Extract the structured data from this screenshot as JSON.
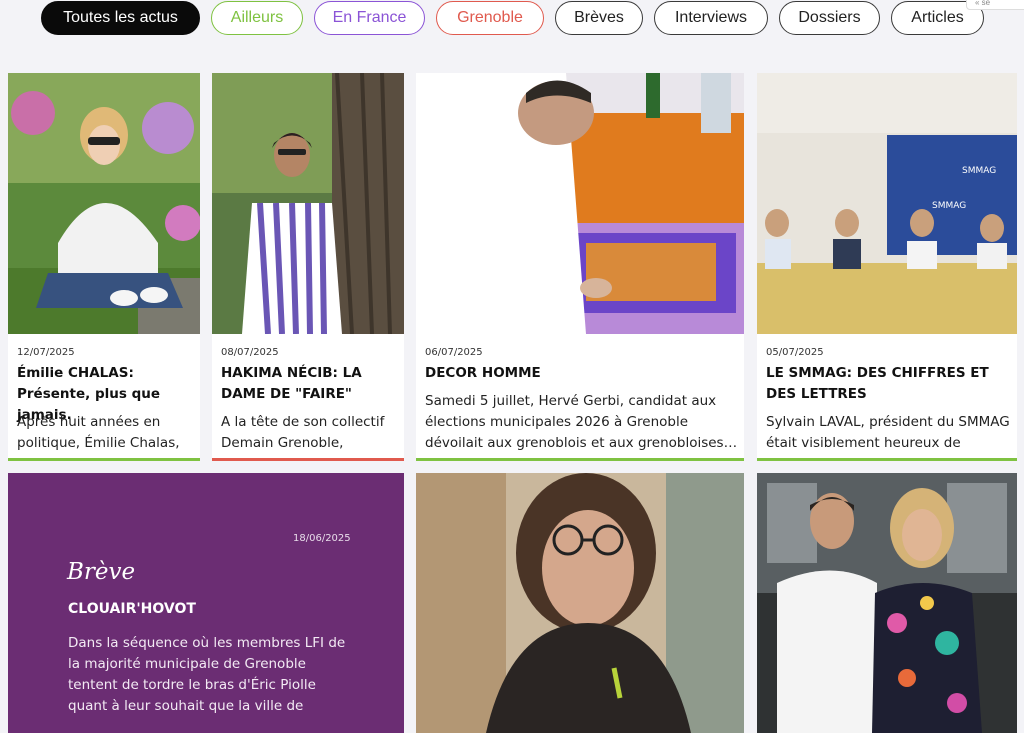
{
  "filters": [
    {
      "label": "Toutes les actus",
      "active": true,
      "color": "#0a0a0a"
    },
    {
      "label": "Ailleurs",
      "active": false,
      "color": "#7fc241"
    },
    {
      "label": "En France",
      "active": false,
      "color": "#8b54d6"
    },
    {
      "label": "Grenoble",
      "active": false,
      "color": "#e05a4e"
    },
    {
      "label": "Brèves",
      "active": false,
      "color": "#3a3a3a"
    },
    {
      "label": "Interviews",
      "active": false,
      "color": "#3a3a3a"
    },
    {
      "label": "Dossiers",
      "active": false,
      "color": "#3a3a3a"
    },
    {
      "label": "Articles",
      "active": false,
      "color": "#3a3a3a"
    }
  ],
  "corner_tab": "« se",
  "articles": [
    {
      "date": "12/07/2025",
      "title": "Émilie CHALAS: Présente, plus que jamais.",
      "excerpt": "Après huit années en politique, Émilie Chalas,",
      "accent": "#7fc241"
    },
    {
      "date": "08/07/2025",
      "title": "HAKIMA NÉCIB: LA DAME DE \"FAIRE\"",
      "excerpt": "A la tête de son collectif Demain Grenoble,",
      "accent": "#e05a4e"
    },
    {
      "date": "06/07/2025",
      "title": "DECOR HOMME",
      "excerpt": "Samedi 5 juillet, Hervé Gerbi, candidat aux élections municipales 2026 à Grenoble dévoilait aux grenoblois et aux grenobloises…",
      "accent": "#7fc241"
    },
    {
      "date": "05/07/2025",
      "title": "LE SMMAG: DES CHIFFRES ET DES LETTRES",
      "excerpt": "Sylvain LAVAL, président du SMMAG était visiblement heureux de",
      "accent": "#7fc241"
    }
  ],
  "breve": {
    "date": "18/06/2025",
    "label": "Brève",
    "title": "CLOUAIR'HOVOT",
    "text": "Dans la séquence où les membres LFI de la majorité municipale de Grenoble tentent de tordre le bras d'Éric Piolle quant à leur souhait que la ville de",
    "background": "#6b2d73"
  }
}
